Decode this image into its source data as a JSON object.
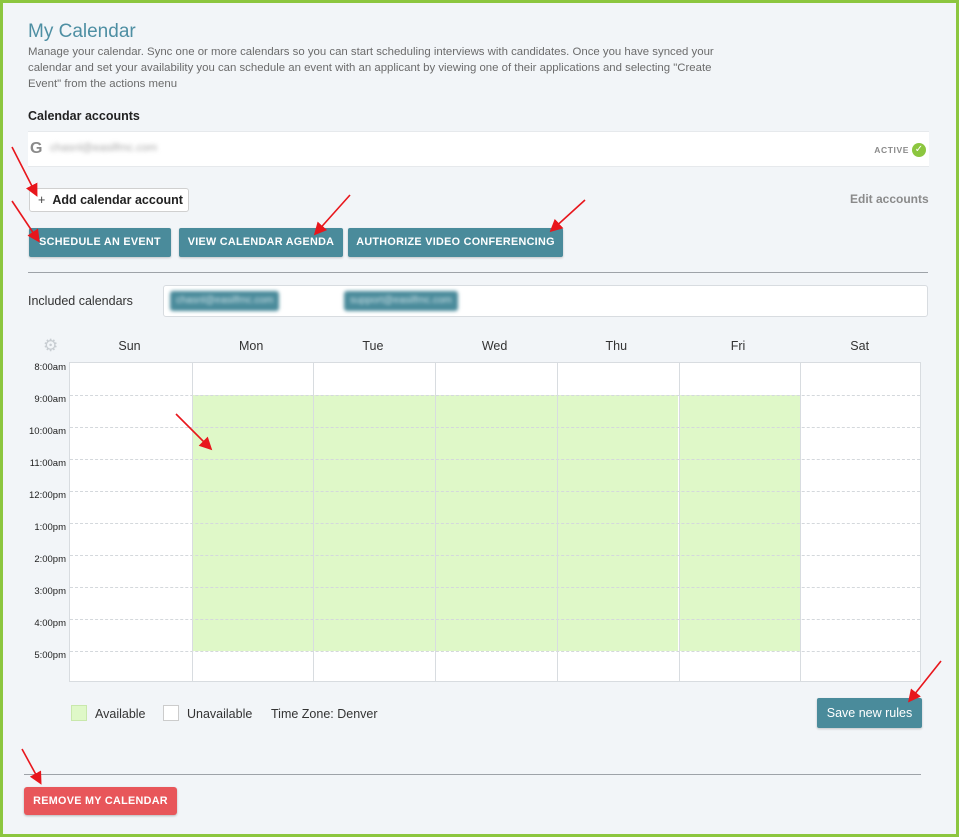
{
  "page": {
    "title": "My Calendar",
    "description": "Manage your calendar. Sync one or more calendars so you can start scheduling interviews with candidates. Once you have synced your calendar and set your availability you can schedule an event with an applicant by viewing one of their applications and selecting \"Create Event\" from the actions menu"
  },
  "accounts": {
    "heading": "Calendar accounts",
    "items": [
      {
        "provider_icon": "google-icon",
        "provider_glyph": "G",
        "email": "chasnl@easilfmc.com",
        "status": "ACTIVE",
        "status_color": "#8cc63f"
      }
    ],
    "add_label": "Add calendar account",
    "add_glyph": "+",
    "edit_label": "Edit accounts"
  },
  "actions": {
    "schedule_label": "SCHEDULE AN EVENT",
    "agenda_label": "VIEW CALENDAR AGENDA",
    "authorize_label": "AUTHORIZE VIDEO CONFERENCING"
  },
  "included": {
    "label": "Included calendars",
    "chips": [
      "chasnl@easilfmc.com",
      "support@easilfmc.com"
    ]
  },
  "calendar": {
    "settings_icon": "gear-icon",
    "days": [
      "Sun",
      "Mon",
      "Tue",
      "Wed",
      "Thu",
      "Fri",
      "Sat"
    ],
    "times": [
      "8:00am",
      "9:00am",
      "10:00am",
      "11:00am",
      "12:00pm",
      "1:00pm",
      "2:00pm",
      "3:00pm",
      "4:00pm",
      "5:00pm"
    ],
    "available_days": [
      "Mon",
      "Tue",
      "Wed",
      "Thu",
      "Fri"
    ],
    "available_from": "9:00am",
    "available_to": "5:00pm",
    "available_color": "#dff8c8"
  },
  "legend": {
    "available_label": "Available",
    "unavailable_label": "Unavailable",
    "timezone_label": "Time Zone: Denver"
  },
  "save_label": "Save new rules",
  "remove_label": "REMOVE MY CALENDAR",
  "colors": {
    "accent": "#4a8b9b",
    "danger": "#e8565a",
    "annotation": "#e8161c",
    "frame": "#8cc63f"
  }
}
